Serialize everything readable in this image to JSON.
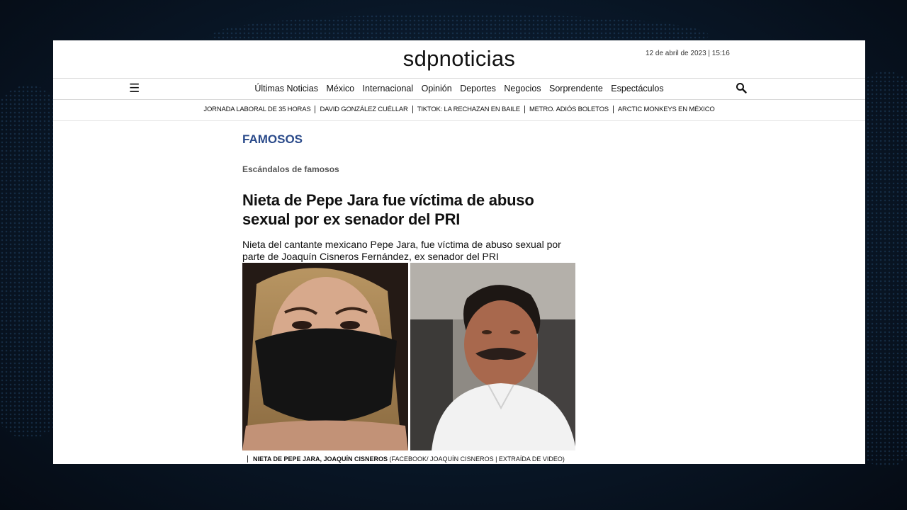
{
  "header": {
    "logo": "sdpnoticias",
    "date": "12 de abril de 2023 | 15:16"
  },
  "nav": {
    "menu_icon": "hamburger-icon",
    "items": [
      "Últimas Noticias",
      "México",
      "Internacional",
      "Opinión",
      "Deportes",
      "Negocios",
      "Sorprendente",
      "Espectáculos"
    ],
    "search_icon": "search-icon"
  },
  "trending": [
    "JORNADA LABORAL DE 35 HORAS",
    "DAVID GONZÁLEZ CUÉLLAR",
    "TIKTOK: LA RECHAZAN EN BAILE",
    "METRO. ADIÓS BOLETOS",
    "ARCTIC MONKEYS EN MÉXICO"
  ],
  "article": {
    "section": "FAMOSOS",
    "subsection": "Escándalos de famosos",
    "title": "Nieta de Pepe Jara fue víctima de abuso sexual por ex senador del PRI",
    "summary": "Nieta del cantante mexicano Pepe Jara, fue víctima de abuso sexual por parte de Joaquín Cisneros Fernández, ex senador del PRI",
    "caption_bold": "NIETA DE PEPE JARA, JOAQUÍN CISNEROS",
    "caption_credit": " (FACEBOOK/ JOAQUÍN CISNEROS | EXTRAÍDA DE VIDEO)"
  },
  "colors": {
    "section": "#2a4a8a",
    "background": "#0a1a2c"
  }
}
